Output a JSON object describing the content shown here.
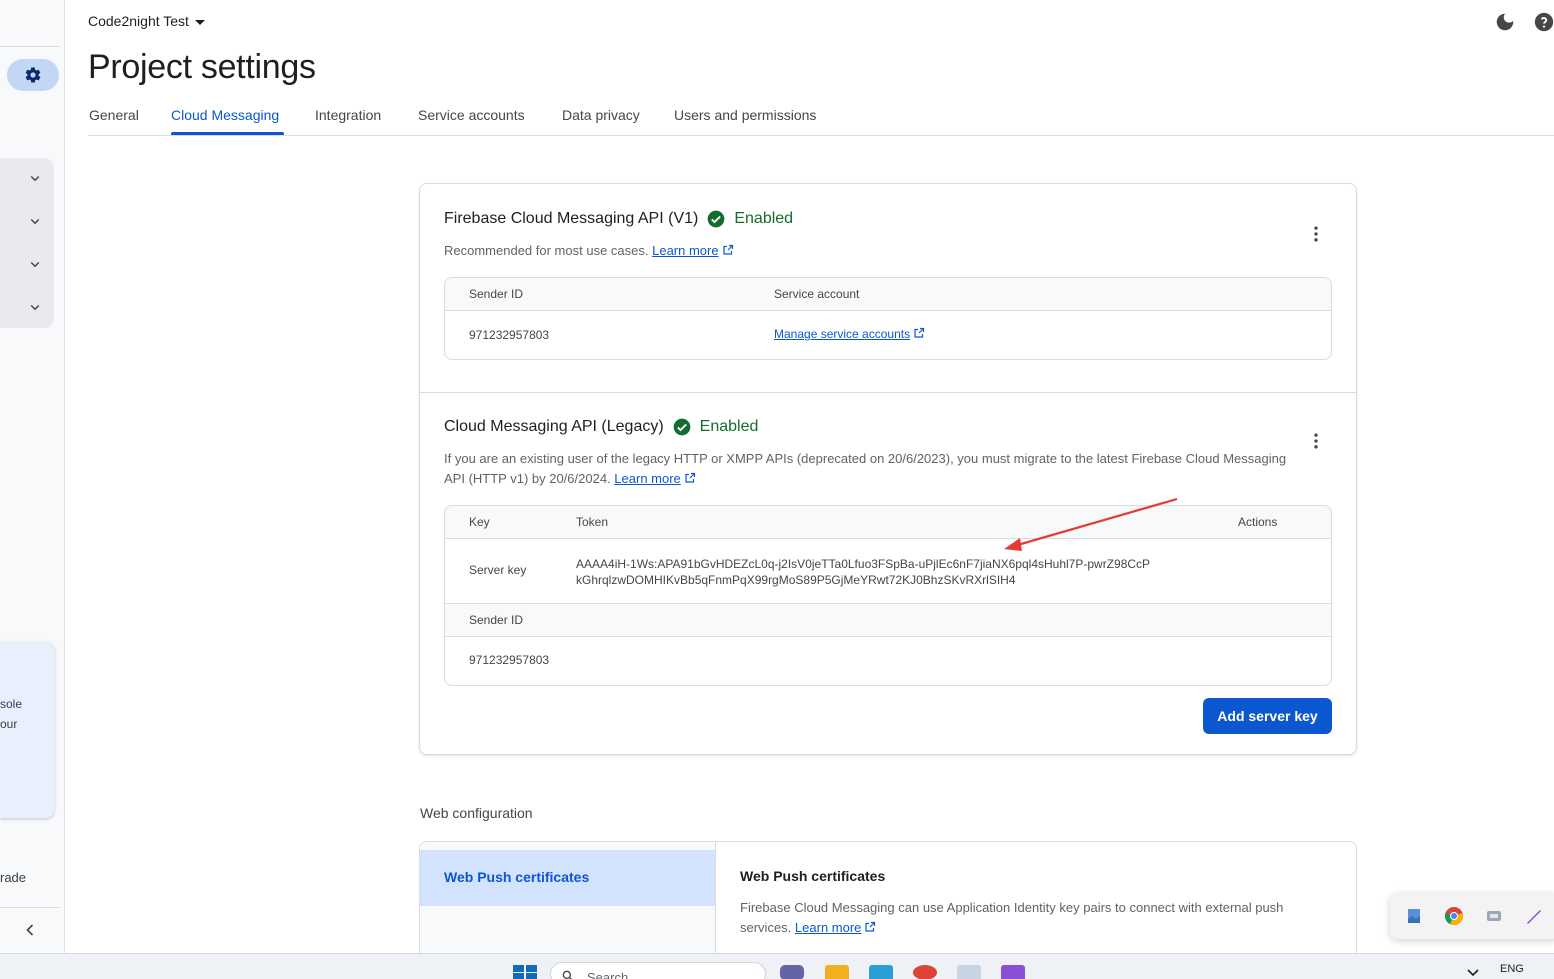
{
  "header": {
    "project_name": "Code2night Test",
    "title": "Project settings"
  },
  "tabs": [
    {
      "label": "General"
    },
    {
      "label": "Cloud Messaging"
    },
    {
      "label": "Integration"
    },
    {
      "label": "Service accounts"
    },
    {
      "label": "Data privacy"
    },
    {
      "label": "Users and permissions"
    }
  ],
  "sidebar": {
    "promo_lines": [
      "sole",
      "our"
    ],
    "upgrade_text": "rade"
  },
  "fcm_v1": {
    "title": "Firebase Cloud Messaging API (V1)",
    "status": "Enabled",
    "description": "Recommended for most use cases.",
    "learn_more": "Learn more",
    "columns": [
      "Sender ID",
      "Service account"
    ],
    "sender_id": "971232957803",
    "manage_link": "Manage service accounts"
  },
  "legacy": {
    "title": "Cloud Messaging API (Legacy)",
    "status": "Enabled",
    "description": "If you are an existing user of the legacy HTTP or XMPP APIs (deprecated on 20/6/2023), you must migrate to the latest Firebase Cloud Messaging API (HTTP v1) by 20/6/2024.",
    "learn_more": "Learn more",
    "columns": [
      "Key",
      "Token",
      "Actions"
    ],
    "key_name": "Server key",
    "token_line1": "AAAA4iH-1Ws:APA91bGvHDEZcL0q-j2IsV0jeTTa0Lfuo3FSpBa-uPjlEc6nF7jiaNX6pql4sHuhl7P-pwrZ98CcP",
    "token_line2": "kGhrqlzwDOMHIKvBb5qFnmPqX99rgMoS89P5GjMeYRwt72KJ0BhzSKvRXrlSIH4",
    "sender_header": "Sender ID",
    "sender_id": "971232957803",
    "add_button": "Add server key"
  },
  "web_config": {
    "section_title": "Web configuration",
    "nav_item": "Web Push certificates",
    "panel_title": "Web Push certificates",
    "panel_desc": "Firebase Cloud Messaging can use Application Identity key pairs to connect with external push services.",
    "learn_more": "Learn more"
  },
  "taskbar": {
    "search_placeholder": "Search",
    "language": "ENG"
  },
  "colors": {
    "accent": "#0b57d0",
    "enabled_green": "#146c2e",
    "annotation_red": "#e53935"
  }
}
